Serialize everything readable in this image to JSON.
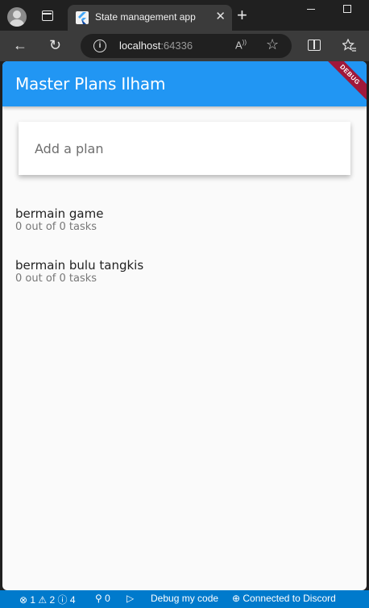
{
  "browser": {
    "tab_title": "State management app",
    "tab_close": "✕",
    "new_tab": "+",
    "url_host": "localhost",
    "url_port": ":64336",
    "read_aloud": "A",
    "favorite": "☆",
    "back": "←",
    "reload": "↻"
  },
  "app": {
    "title": "Master Plans Ilham",
    "debug_label": "DEBUG",
    "input_placeholder": "Add a plan",
    "plans": [
      {
        "name": "bermain game",
        "progress": "0 out of 0 tasks"
      },
      {
        "name": "bermain bulu tangkis",
        "progress": "0 out of 0 tasks"
      }
    ]
  },
  "statusbar": {
    "problems": "⊗ 1 ⚠ 2 ⓘ 4",
    "ports": "0",
    "debug_label": "Debug my code",
    "discord": "Connected to Discord"
  },
  "colors": {
    "appbar": "#2196f3",
    "statusbar": "#007acc",
    "debug_banner": "#a0183a"
  }
}
